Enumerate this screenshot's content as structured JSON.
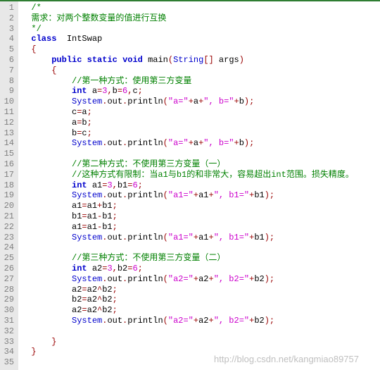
{
  "lines": [
    {
      "n": 1,
      "seg": [
        {
          "t": "  ",
          "c": ""
        },
        {
          "t": "/*",
          "c": "c-comment"
        }
      ]
    },
    {
      "n": 2,
      "seg": [
        {
          "t": "  ",
          "c": ""
        },
        {
          "t": "需求：对两个整数变量的值进行互换",
          "c": "c-comment"
        }
      ]
    },
    {
      "n": 3,
      "seg": [
        {
          "t": "  ",
          "c": ""
        },
        {
          "t": "*/",
          "c": "c-comment"
        }
      ]
    },
    {
      "n": 4,
      "seg": [
        {
          "t": "  ",
          "c": ""
        },
        {
          "t": "class",
          "c": "c-keyword"
        },
        {
          "t": "  ",
          "c": ""
        },
        {
          "t": "IntSwap",
          "c": "c-class"
        }
      ]
    },
    {
      "n": 5,
      "seg": [
        {
          "t": "  {",
          "c": "c-punct"
        }
      ]
    },
    {
      "n": 6,
      "seg": [
        {
          "t": "      ",
          "c": ""
        },
        {
          "t": "public",
          "c": "c-keyword"
        },
        {
          "t": " ",
          "c": ""
        },
        {
          "t": "static",
          "c": "c-keyword"
        },
        {
          "t": " ",
          "c": ""
        },
        {
          "t": "void",
          "c": "c-keyword"
        },
        {
          "t": " ",
          "c": ""
        },
        {
          "t": "main",
          "c": "c-ident"
        },
        {
          "t": "(",
          "c": "c-punct"
        },
        {
          "t": "String",
          "c": "c-type"
        },
        {
          "t": "[] ",
          "c": "c-punct"
        },
        {
          "t": "args",
          "c": "c-ident"
        },
        {
          "t": ")",
          "c": "c-punct"
        }
      ]
    },
    {
      "n": 7,
      "seg": [
        {
          "t": "      {",
          "c": "c-punct"
        }
      ]
    },
    {
      "n": 8,
      "seg": [
        {
          "t": "          ",
          "c": ""
        },
        {
          "t": "//第一种方式：使用第三方变量",
          "c": "c-comment"
        }
      ]
    },
    {
      "n": 9,
      "seg": [
        {
          "t": "          ",
          "c": ""
        },
        {
          "t": "int",
          "c": "c-keyword"
        },
        {
          "t": " a",
          "c": "c-ident"
        },
        {
          "t": "=",
          "c": "c-punct"
        },
        {
          "t": "3",
          "c": "c-num"
        },
        {
          "t": ",",
          "c": "c-punct"
        },
        {
          "t": "b",
          "c": "c-ident"
        },
        {
          "t": "=",
          "c": "c-punct"
        },
        {
          "t": "6",
          "c": "c-num"
        },
        {
          "t": ",",
          "c": "c-punct"
        },
        {
          "t": "c",
          "c": "c-ident"
        },
        {
          "t": ";",
          "c": "c-punct"
        }
      ]
    },
    {
      "n": 10,
      "seg": [
        {
          "t": "          ",
          "c": ""
        },
        {
          "t": "System",
          "c": "c-type"
        },
        {
          "t": ".",
          "c": "c-punct"
        },
        {
          "t": "out",
          "c": "c-ident"
        },
        {
          "t": ".",
          "c": "c-punct"
        },
        {
          "t": "println",
          "c": "c-ident"
        },
        {
          "t": "(",
          "c": "c-punct"
        },
        {
          "t": "\"a=\"",
          "c": "c-string"
        },
        {
          "t": "+",
          "c": "c-punct"
        },
        {
          "t": "a",
          "c": "c-ident"
        },
        {
          "t": "+",
          "c": "c-punct"
        },
        {
          "t": "\", b=\"",
          "c": "c-string"
        },
        {
          "t": "+",
          "c": "c-punct"
        },
        {
          "t": "b",
          "c": "c-ident"
        },
        {
          "t": ");",
          "c": "c-punct"
        }
      ]
    },
    {
      "n": 11,
      "seg": [
        {
          "t": "          c",
          "c": "c-ident"
        },
        {
          "t": "=",
          "c": "c-punct"
        },
        {
          "t": "a",
          "c": "c-ident"
        },
        {
          "t": ";",
          "c": "c-punct"
        }
      ]
    },
    {
      "n": 12,
      "seg": [
        {
          "t": "          a",
          "c": "c-ident"
        },
        {
          "t": "=",
          "c": "c-punct"
        },
        {
          "t": "b",
          "c": "c-ident"
        },
        {
          "t": ";",
          "c": "c-punct"
        }
      ]
    },
    {
      "n": 13,
      "seg": [
        {
          "t": "          b",
          "c": "c-ident"
        },
        {
          "t": "=",
          "c": "c-punct"
        },
        {
          "t": "c",
          "c": "c-ident"
        },
        {
          "t": ";",
          "c": "c-punct"
        }
      ]
    },
    {
      "n": 14,
      "seg": [
        {
          "t": "          ",
          "c": ""
        },
        {
          "t": "System",
          "c": "c-type"
        },
        {
          "t": ".",
          "c": "c-punct"
        },
        {
          "t": "out",
          "c": "c-ident"
        },
        {
          "t": ".",
          "c": "c-punct"
        },
        {
          "t": "println",
          "c": "c-ident"
        },
        {
          "t": "(",
          "c": "c-punct"
        },
        {
          "t": "\"a=\"",
          "c": "c-string"
        },
        {
          "t": "+",
          "c": "c-punct"
        },
        {
          "t": "a",
          "c": "c-ident"
        },
        {
          "t": "+",
          "c": "c-punct"
        },
        {
          "t": "\", b=\"",
          "c": "c-string"
        },
        {
          "t": "+",
          "c": "c-punct"
        },
        {
          "t": "b",
          "c": "c-ident"
        },
        {
          "t": ");",
          "c": "c-punct"
        }
      ]
    },
    {
      "n": 15,
      "seg": [
        {
          "t": " ",
          "c": ""
        }
      ]
    },
    {
      "n": 16,
      "seg": [
        {
          "t": "          ",
          "c": ""
        },
        {
          "t": "//第二种方式：不使用第三方变量（一）",
          "c": "c-comment"
        }
      ]
    },
    {
      "n": 17,
      "seg": [
        {
          "t": "          ",
          "c": ""
        },
        {
          "t": "//这种方式有限制：当a1与b1的和非常大，容易超出int范围。损失精度。",
          "c": "c-comment"
        }
      ]
    },
    {
      "n": 18,
      "seg": [
        {
          "t": "          ",
          "c": ""
        },
        {
          "t": "int",
          "c": "c-keyword"
        },
        {
          "t": " a1",
          "c": "c-ident"
        },
        {
          "t": "=",
          "c": "c-punct"
        },
        {
          "t": "3",
          "c": "c-num"
        },
        {
          "t": ",",
          "c": "c-punct"
        },
        {
          "t": "b1",
          "c": "c-ident"
        },
        {
          "t": "=",
          "c": "c-punct"
        },
        {
          "t": "6",
          "c": "c-num"
        },
        {
          "t": ";",
          "c": "c-punct"
        }
      ]
    },
    {
      "n": 19,
      "seg": [
        {
          "t": "          ",
          "c": ""
        },
        {
          "t": "System",
          "c": "c-type"
        },
        {
          "t": ".",
          "c": "c-punct"
        },
        {
          "t": "out",
          "c": "c-ident"
        },
        {
          "t": ".",
          "c": "c-punct"
        },
        {
          "t": "println",
          "c": "c-ident"
        },
        {
          "t": "(",
          "c": "c-punct"
        },
        {
          "t": "\"a1=\"",
          "c": "c-string"
        },
        {
          "t": "+",
          "c": "c-punct"
        },
        {
          "t": "a1",
          "c": "c-ident"
        },
        {
          "t": "+",
          "c": "c-punct"
        },
        {
          "t": "\", b1=\"",
          "c": "c-string"
        },
        {
          "t": "+",
          "c": "c-punct"
        },
        {
          "t": "b1",
          "c": "c-ident"
        },
        {
          "t": ");",
          "c": "c-punct"
        }
      ]
    },
    {
      "n": 20,
      "seg": [
        {
          "t": "          a1",
          "c": "c-ident"
        },
        {
          "t": "=",
          "c": "c-punct"
        },
        {
          "t": "a1",
          "c": "c-ident"
        },
        {
          "t": "+",
          "c": "c-punct"
        },
        {
          "t": "b1",
          "c": "c-ident"
        },
        {
          "t": ";",
          "c": "c-punct"
        }
      ]
    },
    {
      "n": 21,
      "seg": [
        {
          "t": "          b1",
          "c": "c-ident"
        },
        {
          "t": "=",
          "c": "c-punct"
        },
        {
          "t": "a1",
          "c": "c-ident"
        },
        {
          "t": "-",
          "c": "c-punct"
        },
        {
          "t": "b1",
          "c": "c-ident"
        },
        {
          "t": ";",
          "c": "c-punct"
        }
      ]
    },
    {
      "n": 22,
      "seg": [
        {
          "t": "          a1",
          "c": "c-ident"
        },
        {
          "t": "=",
          "c": "c-punct"
        },
        {
          "t": "a1",
          "c": "c-ident"
        },
        {
          "t": "-",
          "c": "c-punct"
        },
        {
          "t": "b1",
          "c": "c-ident"
        },
        {
          "t": ";",
          "c": "c-punct"
        }
      ]
    },
    {
      "n": 23,
      "seg": [
        {
          "t": "          ",
          "c": ""
        },
        {
          "t": "System",
          "c": "c-type"
        },
        {
          "t": ".",
          "c": "c-punct"
        },
        {
          "t": "out",
          "c": "c-ident"
        },
        {
          "t": ".",
          "c": "c-punct"
        },
        {
          "t": "println",
          "c": "c-ident"
        },
        {
          "t": "(",
          "c": "c-punct"
        },
        {
          "t": "\"a1=\"",
          "c": "c-string"
        },
        {
          "t": "+",
          "c": "c-punct"
        },
        {
          "t": "a1",
          "c": "c-ident"
        },
        {
          "t": "+",
          "c": "c-punct"
        },
        {
          "t": "\", b1=\"",
          "c": "c-string"
        },
        {
          "t": "+",
          "c": "c-punct"
        },
        {
          "t": "b1",
          "c": "c-ident"
        },
        {
          "t": ");",
          "c": "c-punct"
        }
      ]
    },
    {
      "n": 24,
      "seg": [
        {
          "t": " ",
          "c": ""
        }
      ]
    },
    {
      "n": 25,
      "seg": [
        {
          "t": "          ",
          "c": ""
        },
        {
          "t": "//第三种方式：不使用第三方变量（二）",
          "c": "c-comment"
        }
      ]
    },
    {
      "n": 26,
      "seg": [
        {
          "t": "          ",
          "c": ""
        },
        {
          "t": "int",
          "c": "c-keyword"
        },
        {
          "t": " a2",
          "c": "c-ident"
        },
        {
          "t": "=",
          "c": "c-punct"
        },
        {
          "t": "3",
          "c": "c-num"
        },
        {
          "t": ",",
          "c": "c-punct"
        },
        {
          "t": "b2",
          "c": "c-ident"
        },
        {
          "t": "=",
          "c": "c-punct"
        },
        {
          "t": "6",
          "c": "c-num"
        },
        {
          "t": ";",
          "c": "c-punct"
        }
      ]
    },
    {
      "n": 27,
      "seg": [
        {
          "t": "          ",
          "c": ""
        },
        {
          "t": "System",
          "c": "c-type"
        },
        {
          "t": ".",
          "c": "c-punct"
        },
        {
          "t": "out",
          "c": "c-ident"
        },
        {
          "t": ".",
          "c": "c-punct"
        },
        {
          "t": "println",
          "c": "c-ident"
        },
        {
          "t": "(",
          "c": "c-punct"
        },
        {
          "t": "\"a2=\"",
          "c": "c-string"
        },
        {
          "t": "+",
          "c": "c-punct"
        },
        {
          "t": "a2",
          "c": "c-ident"
        },
        {
          "t": "+",
          "c": "c-punct"
        },
        {
          "t": "\", b2=\"",
          "c": "c-string"
        },
        {
          "t": "+",
          "c": "c-punct"
        },
        {
          "t": "b2",
          "c": "c-ident"
        },
        {
          "t": ");",
          "c": "c-punct"
        }
      ]
    },
    {
      "n": 28,
      "seg": [
        {
          "t": "          a2",
          "c": "c-ident"
        },
        {
          "t": "=",
          "c": "c-punct"
        },
        {
          "t": "a2",
          "c": "c-ident"
        },
        {
          "t": "^",
          "c": "c-punct"
        },
        {
          "t": "b2",
          "c": "c-ident"
        },
        {
          "t": ";",
          "c": "c-punct"
        }
      ]
    },
    {
      "n": 29,
      "seg": [
        {
          "t": "          b2",
          "c": "c-ident"
        },
        {
          "t": "=",
          "c": "c-punct"
        },
        {
          "t": "a2",
          "c": "c-ident"
        },
        {
          "t": "^",
          "c": "c-punct"
        },
        {
          "t": "b2",
          "c": "c-ident"
        },
        {
          "t": ";",
          "c": "c-punct"
        }
      ]
    },
    {
      "n": 30,
      "seg": [
        {
          "t": "          a2",
          "c": "c-ident"
        },
        {
          "t": "=",
          "c": "c-punct"
        },
        {
          "t": "a2",
          "c": "c-ident"
        },
        {
          "t": "^",
          "c": "c-punct"
        },
        {
          "t": "b2",
          "c": "c-ident"
        },
        {
          "t": ";",
          "c": "c-punct"
        }
      ]
    },
    {
      "n": 31,
      "seg": [
        {
          "t": "          ",
          "c": ""
        },
        {
          "t": "System",
          "c": "c-type"
        },
        {
          "t": ".",
          "c": "c-punct"
        },
        {
          "t": "out",
          "c": "c-ident"
        },
        {
          "t": ".",
          "c": "c-punct"
        },
        {
          "t": "println",
          "c": "c-ident"
        },
        {
          "t": "(",
          "c": "c-punct"
        },
        {
          "t": "\"a2=\"",
          "c": "c-string"
        },
        {
          "t": "+",
          "c": "c-punct"
        },
        {
          "t": "a2",
          "c": "c-ident"
        },
        {
          "t": "+",
          "c": "c-punct"
        },
        {
          "t": "\", b2=\"",
          "c": "c-string"
        },
        {
          "t": "+",
          "c": "c-punct"
        },
        {
          "t": "b2",
          "c": "c-ident"
        },
        {
          "t": ");",
          "c": "c-punct"
        }
      ]
    },
    {
      "n": 32,
      "seg": [
        {
          "t": " ",
          "c": ""
        }
      ]
    },
    {
      "n": 33,
      "seg": [
        {
          "t": "      }",
          "c": "c-punct"
        }
      ]
    },
    {
      "n": 34,
      "seg": [
        {
          "t": "  }",
          "c": "c-punct"
        }
      ]
    },
    {
      "n": 35,
      "seg": [
        {
          "t": " ",
          "c": ""
        }
      ]
    }
  ],
  "watermark": "http://blog.csdn.net/kangmiao89757"
}
